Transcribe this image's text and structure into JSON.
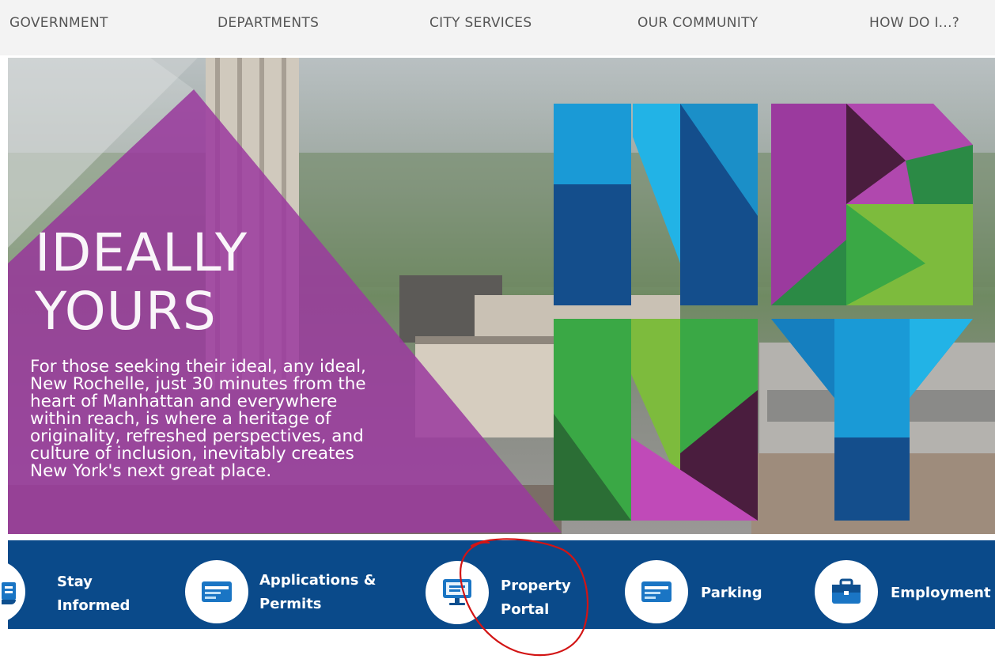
{
  "nav": {
    "items": [
      "GOVERNMENT",
      "DEPARTMENTS",
      "CITY SERVICES",
      "OUR COMMUNITY",
      "HOW DO I...?"
    ]
  },
  "hero": {
    "title_line1": "IDEALLY",
    "title_line2": "YOURS",
    "body_lines": [
      "For those seeking their ideal, any ideal,",
      "New Rochelle, just 30 minutes from the",
      "heart of Manhattan and everywhere",
      "within reach, is where a heritage of",
      "originality, refreshed perspectives, and",
      "culture of inclusion, inevitably creates",
      "New York's next great place."
    ],
    "logo_text": "NR NY",
    "colors": {
      "purple": "#9b3a9e",
      "blue": "#1a9ad6",
      "dark_blue": "#144e8c",
      "green": "#3aa845",
      "lime": "#7dbb3d"
    }
  },
  "quick_links": {
    "bar_color": "#0a4a8a",
    "items": [
      {
        "line1": "Stay",
        "line2": "Informed",
        "icon": "newspaper-icon"
      },
      {
        "line1": "Applications &",
        "line2": "Permits",
        "icon": "card-icon"
      },
      {
        "line1": "Property",
        "line2": "Portal",
        "icon": "monitor-icon"
      },
      {
        "line1": "Parking",
        "line2": "",
        "icon": "card-icon"
      },
      {
        "line1": "Employment",
        "line2": "",
        "icon": "briefcase-icon"
      }
    ]
  },
  "annotation": {
    "color": "#d21414",
    "encircled_item": "Property Portal"
  }
}
